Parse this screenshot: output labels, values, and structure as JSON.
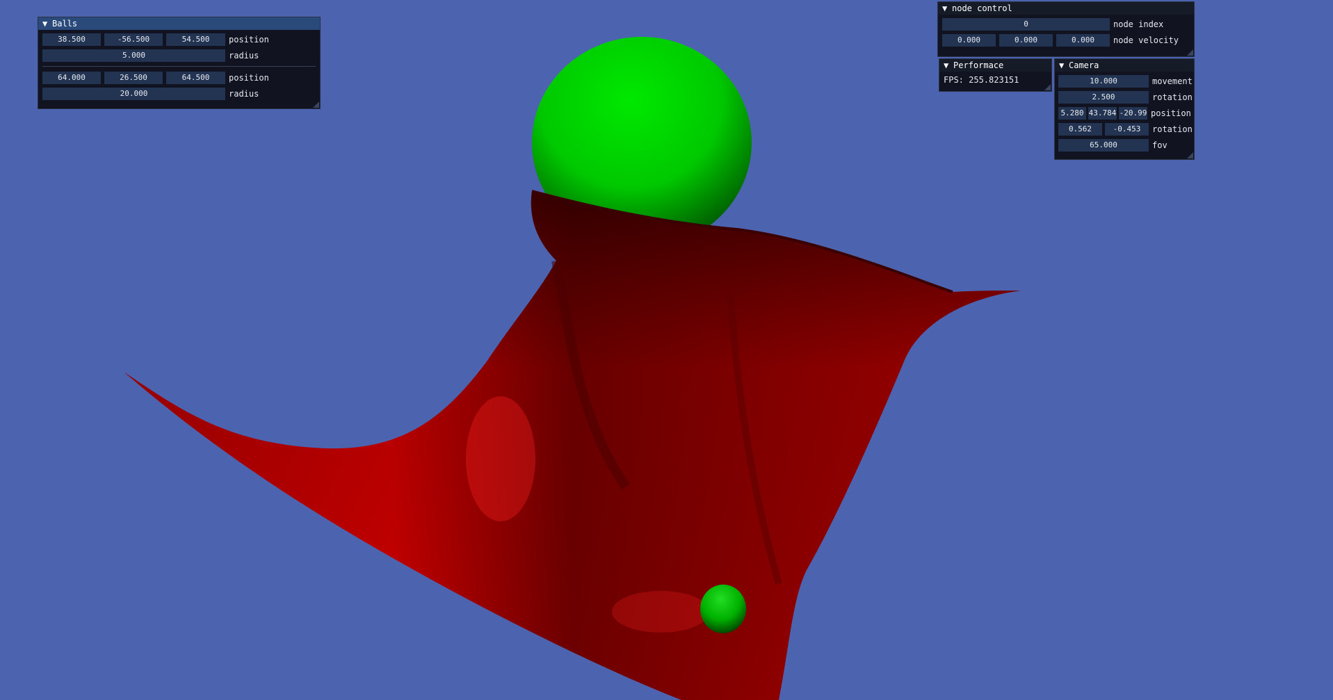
{
  "balls_window": {
    "title": "Balls",
    "balls": [
      {
        "position": [
          "38.500",
          "-56.500",
          "54.500"
        ],
        "position_label": "position",
        "radius": "5.000",
        "radius_label": "radius"
      },
      {
        "position": [
          "64.000",
          "26.500",
          "64.500"
        ],
        "position_label": "position",
        "radius": "20.000",
        "radius_label": "radius"
      }
    ]
  },
  "node_control": {
    "title": "node control",
    "node_index": "0",
    "node_index_label": "node index",
    "node_velocity": [
      "0.000",
      "0.000",
      "0.000"
    ],
    "node_velocity_label": "node velocity"
  },
  "performance": {
    "title": "Performace",
    "fps_text": "FPS: 255.823151"
  },
  "camera": {
    "title": "Camera",
    "movement": "10.000",
    "movement_label": "movement",
    "rotation_speed": "2.500",
    "rotation_speed_label": "rotation",
    "position": [
      "5.280",
      "43.784",
      "-20.99"
    ],
    "position_label": "position",
    "rotation": [
      "0.562",
      "-0.453"
    ],
    "rotation_label": "rotation",
    "fov": "65.000",
    "fov_label": "fov"
  },
  "colors": {
    "background": "#4c64b0",
    "cloth": "#d40000",
    "ball": "#00d000",
    "panel": "#0f111a",
    "field": "#233452",
    "title_active": "#294a7a"
  }
}
